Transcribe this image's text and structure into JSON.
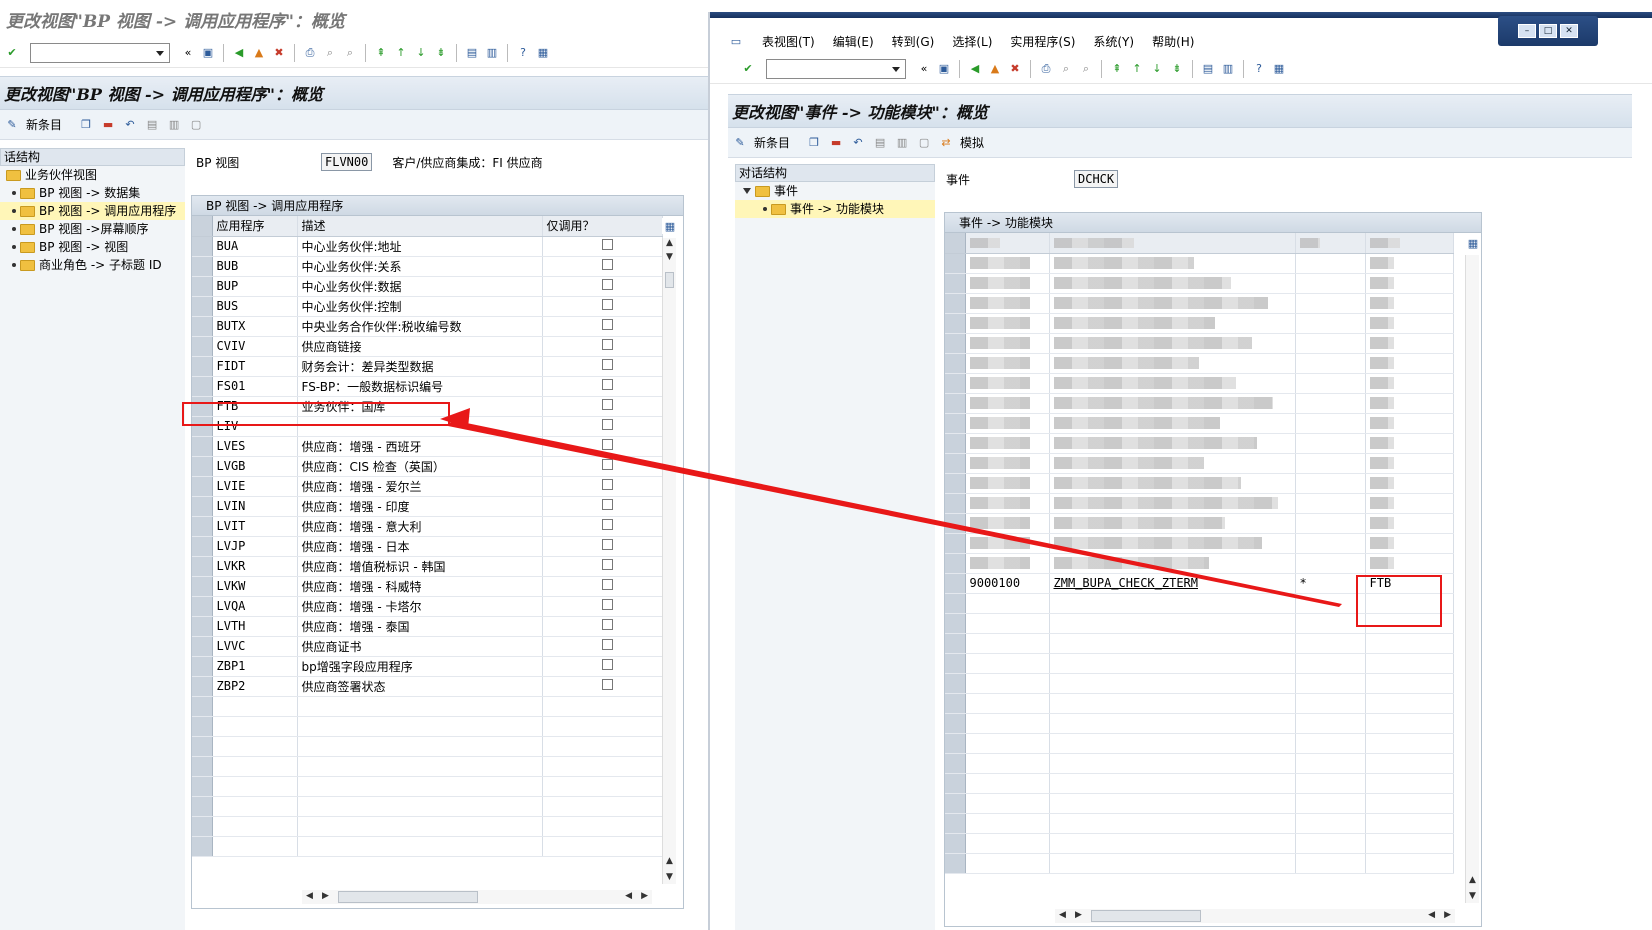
{
  "left": {
    "title": "更改视图\"BP 视图 -> 调用应用程序\"：概览",
    "screen_header": "更改视图\"BP 视图 -> 调用应用程序\"：概览",
    "new_entries": "新条目",
    "tree_header": "话结构",
    "tree": [
      {
        "label": "业务伙伴视图",
        "level": 0
      },
      {
        "label": "BP 视图 -> 数据集",
        "level": 1
      },
      {
        "label": "BP 视图 -> 调用应用程序",
        "level": 1,
        "selected": true
      },
      {
        "label": "BP 视图 ->屏幕顺序",
        "level": 1
      },
      {
        "label": "BP 视图 -> 视图",
        "level": 1
      },
      {
        "label": "商业角色 -> 子标题 ID",
        "level": 1
      }
    ],
    "field_bpview_label": "BP 视图",
    "field_bpview_value": "FLVN00",
    "field_info": "客户/供应商集成：FI 供应商",
    "table_caption": "BP 视图 -> 调用应用程序",
    "columns": [
      "应用程序",
      "描述",
      "仅调用？"
    ],
    "rows": [
      {
        "app": "BUA",
        "desc": "中心业务伙伴:地址"
      },
      {
        "app": "BUB",
        "desc": "中心业务伙伴:关系"
      },
      {
        "app": "BUP",
        "desc": "中心业务伙伴:数据"
      },
      {
        "app": "BUS",
        "desc": "中心业务伙伴:控制"
      },
      {
        "app": "BUTX",
        "desc": "中央业务合作伙伴:税收编号数"
      },
      {
        "app": "CVIV",
        "desc": "供应商链接"
      },
      {
        "app": "FIDT",
        "desc": "财务会计：差异类型数据"
      },
      {
        "app": "FS01",
        "desc": "FS-BP：一般数据标识编号"
      },
      {
        "app": "FTB",
        "desc": "业务伙伴：国库"
      },
      {
        "app": "LIV",
        "desc": ""
      },
      {
        "app": "LVES",
        "desc": "供应商：增强 - 西班牙"
      },
      {
        "app": "LVGB",
        "desc": "供应商：CIS 检查（英国）"
      },
      {
        "app": "LVIE",
        "desc": "供应商：增强 - 爱尔兰"
      },
      {
        "app": "LVIN",
        "desc": "供应商：增强 - 印度"
      },
      {
        "app": "LVIT",
        "desc": "供应商：增强 - 意大利"
      },
      {
        "app": "LVJP",
        "desc": "供应商：增强 - 日本"
      },
      {
        "app": "LVKR",
        "desc": "供应商：增值税标识 - 韩国"
      },
      {
        "app": "LVKW",
        "desc": "供应商：增强 - 科威特"
      },
      {
        "app": "LVQA",
        "desc": "供应商：增强 - 卡塔尔"
      },
      {
        "app": "LVTH",
        "desc": "供应商：增强 - 泰国"
      },
      {
        "app": "LVVC",
        "desc": "供应商证书"
      },
      {
        "app": "ZBP1",
        "desc": "bp增强字段应用程序"
      },
      {
        "app": "ZBP2",
        "desc": "供应商签署状态"
      }
    ]
  },
  "right": {
    "menu": [
      "表视图(T)",
      "编辑(E)",
      "转到(G)",
      "选择(L)",
      "实用程序(S)",
      "系统(Y)",
      "帮助(H)"
    ],
    "screen_header": "更改视图\"事件 -> 功能模块\"：概览",
    "new_entries": "新条目",
    "simulate": "模拟",
    "tree_header": "对话结构",
    "tree": [
      {
        "label": "事件",
        "level": 0
      },
      {
        "label": "事件 -> 功能模块",
        "level": 1,
        "selected": true
      }
    ],
    "field_event_label": "事件",
    "field_event_value": "DCHCK",
    "table_caption": "事件 -> 功能模块",
    "visible_row": {
      "number": "9000100",
      "module": "ZMM_BUPA_CHECK_ZTERM",
      "flag": "*",
      "app": "FTB"
    }
  },
  "colors": {
    "annotation": "#e81818",
    "header_bg": "#d6e1ec",
    "selected_tree": "#fff6b8"
  }
}
